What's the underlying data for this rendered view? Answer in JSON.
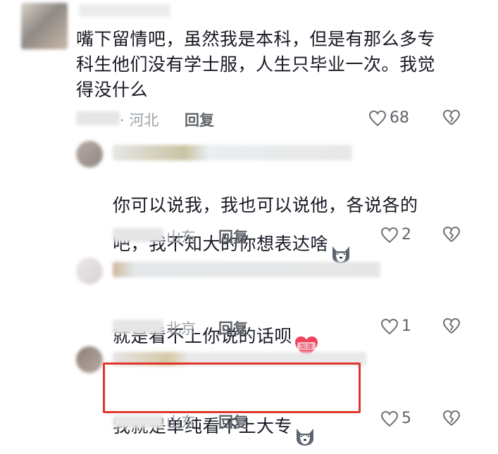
{
  "comments": [
    {
      "text": "嘴下留情吧，虽然我是本科，但是有那么多专\n科生他们没有学士服，人生只毕业一次。我觉\n得没什么",
      "location": "· 河北",
      "reply_label": "回复",
      "likes": "68"
    },
    {
      "text": "你可以说我，我也可以说他，各说各的\n吧，我不知大的你想表达啥",
      "emoji": "husky-emoji",
      "location": "山东",
      "reply_label": "回复",
      "likes": "2"
    },
    {
      "text": "就是看不上你说的话呗",
      "emoji": "jiayou-sticker",
      "sticker_text": "加油",
      "location": "北京",
      "reply_label": "回复",
      "likes": "1"
    },
    {
      "text": "我就是单纯看不上大专",
      "emoji": "husky-emoji",
      "location": "山东",
      "reply_label": "回复",
      "likes": "5"
    }
  ],
  "colors": {
    "highlight": "#e0352b",
    "meta": "#9aa0a6",
    "reply": "#5f646b",
    "text": "#161823"
  }
}
